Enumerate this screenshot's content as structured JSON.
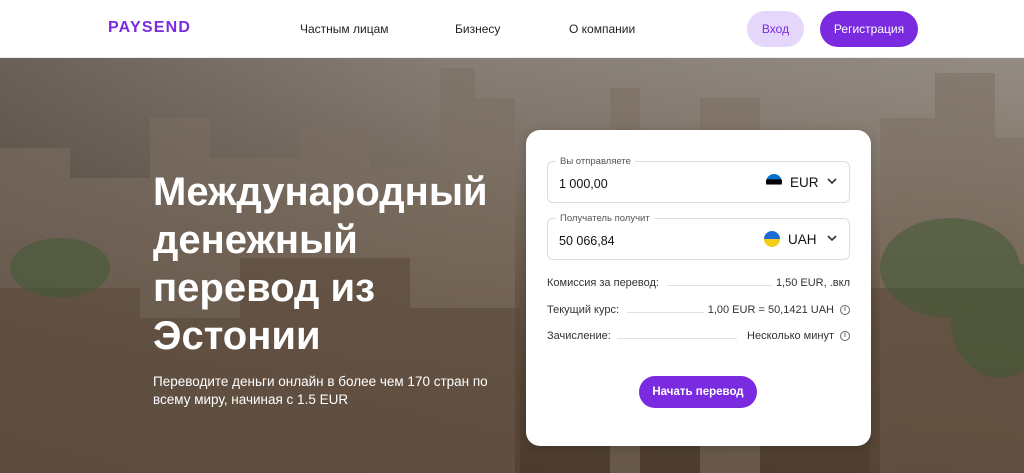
{
  "brand": {
    "logo": "PAYSEND",
    "accent": "#7a2be0",
    "accent_light": "#e4d7fb"
  },
  "nav": {
    "private": "Частным лицам",
    "business": "Бизнесу",
    "about": "О компании",
    "login": "Вход",
    "register": "Регистрация"
  },
  "hero": {
    "title": "Международный денежный перевод из Эстонии",
    "subtitle": "Переводите деньги онлайн в более чем 170 стран по всему миру, начиная с 1.5 EUR"
  },
  "form": {
    "send": {
      "label": "Вы отправляете",
      "amount": "1 000,00",
      "currency": "EUR",
      "flag": "estonia-flag"
    },
    "receive": {
      "label": "Получатель получит",
      "amount": "50 066,84",
      "currency": "UAH",
      "flag": "ukraine-flag"
    },
    "fee": {
      "label": "Комиссия за перевод:",
      "value": "1,50 EUR, .вкл"
    },
    "rate": {
      "label": "Текущий курс:",
      "value": "1,00 EUR = 50,1421 UAH"
    },
    "delivery": {
      "label": "Зачисление:",
      "value": "Несколько минут"
    },
    "submit": "Начать перевод"
  }
}
